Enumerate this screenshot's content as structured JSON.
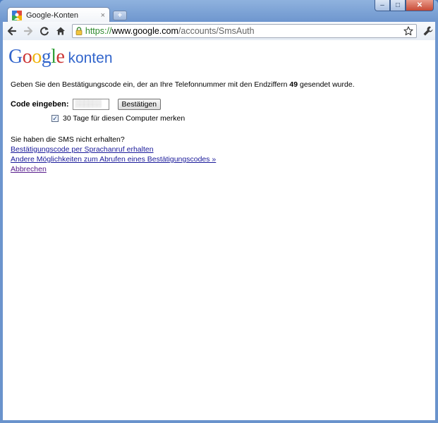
{
  "window": {
    "controls": {
      "minimize": "–",
      "maximize": "□",
      "close": "✕"
    }
  },
  "tab": {
    "title": "Google-Konten",
    "close": "×",
    "new_tab": "+"
  },
  "toolbar": {
    "url_secure": "https://",
    "url_host": "www.google.com",
    "url_path": "/accounts/SmsAuth"
  },
  "logo": {
    "letters": [
      "G",
      "o",
      "o",
      "g",
      "l",
      "e"
    ],
    "colors": [
      "#3366cc",
      "#cc3333",
      "#f0b30a",
      "#3366cc",
      "#33a03a",
      "#cc3333"
    ],
    "product": "konten"
  },
  "main": {
    "intro_before": "Geben Sie den Bestätigungscode ein, der an Ihre Telefonnummer mit den Endziffern ",
    "intro_digits": "49",
    "intro_after": " gesendet wurde.",
    "code_label": "Code eingeben:",
    "code_value": "",
    "confirm_button": "Bestätigen",
    "remember_checked": true,
    "remember_label": "30 Tage für diesen Computer merken",
    "sms_not_received": "Sie haben die SMS nicht erhalten?",
    "links": {
      "voice_call": "Bestätigungscode per Sprachanruf erhalten",
      "other_options": "Andere Möglichkeiten zum Abrufen eines Bestätigungscodes »",
      "cancel": "Abbrechen"
    }
  }
}
